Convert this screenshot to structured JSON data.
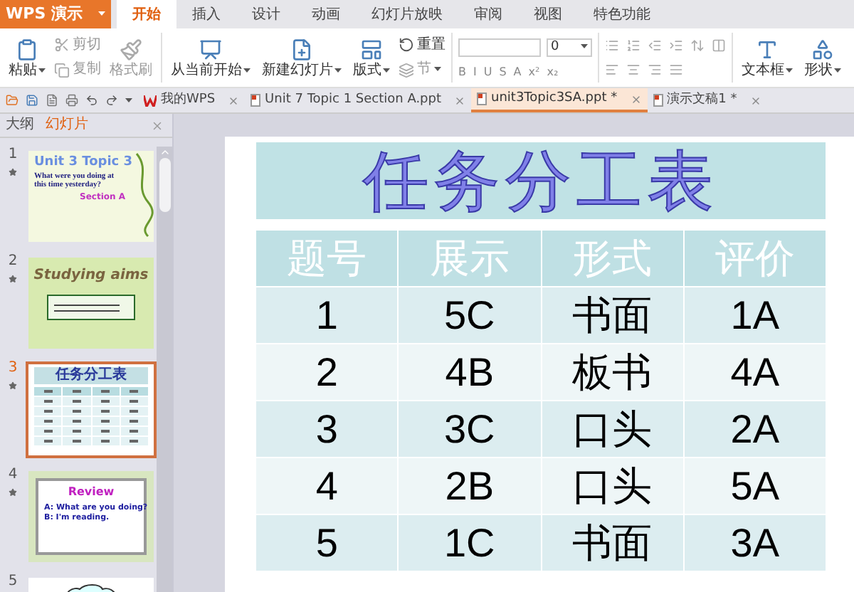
{
  "app_button": {
    "label": "WPS 演示"
  },
  "menu_tabs": [
    {
      "label": "开始",
      "selected": true
    },
    {
      "label": "插入",
      "selected": false
    },
    {
      "label": "设计",
      "selected": false
    },
    {
      "label": "动画",
      "selected": false
    },
    {
      "label": "幻灯片放映",
      "selected": false
    },
    {
      "label": "审阅",
      "selected": false
    },
    {
      "label": "视图",
      "selected": false
    },
    {
      "label": "特色功能",
      "selected": false
    }
  ],
  "ribbon": {
    "clipboard": [
      [
        {
          "kind": "large",
          "label": "粘贴",
          "dropdown": true,
          "disabled": false
        }
      ],
      [
        {
          "kind": "small",
          "label": "剪切",
          "dropdown": false,
          "disabled": true
        },
        {
          "kind": "small",
          "label": "复制",
          "dropdown": false,
          "disabled": true
        }
      ],
      [
        {
          "kind": "large",
          "label": "格式刷",
          "dropdown": false,
          "disabled": true
        }
      ]
    ],
    "slides": [
      [
        {
          "kind": "large",
          "label": "从当前开始",
          "dropdown": true,
          "disabled": false
        }
      ],
      [
        {
          "kind": "large",
          "label": "新建幻灯片",
          "dropdown": true,
          "disabled": false
        }
      ],
      [
        {
          "kind": "large",
          "label": "版式",
          "dropdown": true,
          "disabled": false
        }
      ],
      [
        {
          "kind": "small",
          "label": "重置",
          "dropdown": false,
          "disabled": false
        },
        {
          "kind": "small",
          "label": "节",
          "dropdown": true,
          "disabled": true
        }
      ]
    ],
    "font_size": {
      "value": "0"
    },
    "font_buttons": [
      "B",
      "I",
      "U",
      "S",
      "A",
      "x²",
      "x₂"
    ],
    "insert": [
      [
        {
          "kind": "large",
          "label": "文本框",
          "dropdown": true,
          "disabled": false
        }
      ],
      [
        {
          "kind": "large",
          "label": "形状",
          "dropdown": true,
          "disabled": false
        }
      ]
    ]
  },
  "doc_tabs": [
    {
      "label": "我的WPS",
      "kind": "home",
      "selected": false
    },
    {
      "label": "Unit 7 Topic 1 Section A.ppt",
      "kind": "file",
      "selected": false
    },
    {
      "label": "unit3Topic3SA.ppt *",
      "kind": "file",
      "selected": true
    },
    {
      "label": "演示文稿1 *",
      "kind": "file",
      "selected": false
    }
  ],
  "side_tabs": [
    {
      "label": "大纲",
      "selected": false
    },
    {
      "label": "幻灯片",
      "selected": true
    }
  ],
  "thumbnails": [
    {
      "number": "1",
      "kind": "title",
      "selected": false,
      "title": "Unit 3 Topic 3",
      "text": "What were you doing at this time yesterday?",
      "subtitle": "Section A"
    },
    {
      "number": "2",
      "kind": "aims",
      "selected": false,
      "title": "Studying aims"
    },
    {
      "number": "3",
      "kind": "table",
      "selected": true,
      "title": "任务分工表"
    },
    {
      "number": "4",
      "kind": "review",
      "selected": false,
      "title": "Review",
      "lines": [
        "A: What are you doing?",
        "B: I'm reading."
      ]
    },
    {
      "number": "5",
      "kind": "cloud",
      "selected": false
    }
  ],
  "slide": {
    "title": "任务分工表",
    "columns": [
      "题号",
      "展示",
      "形式",
      "评价"
    ],
    "rows": [
      [
        "1",
        "5C",
        "书面",
        "1A"
      ],
      [
        "2",
        "4B",
        "板书",
        "4A"
      ],
      [
        "3",
        "3C",
        "口头",
        "2A"
      ],
      [
        "4",
        "2B",
        "口头",
        "5A"
      ],
      [
        "5",
        "1C",
        "书面",
        "3A"
      ]
    ]
  }
}
